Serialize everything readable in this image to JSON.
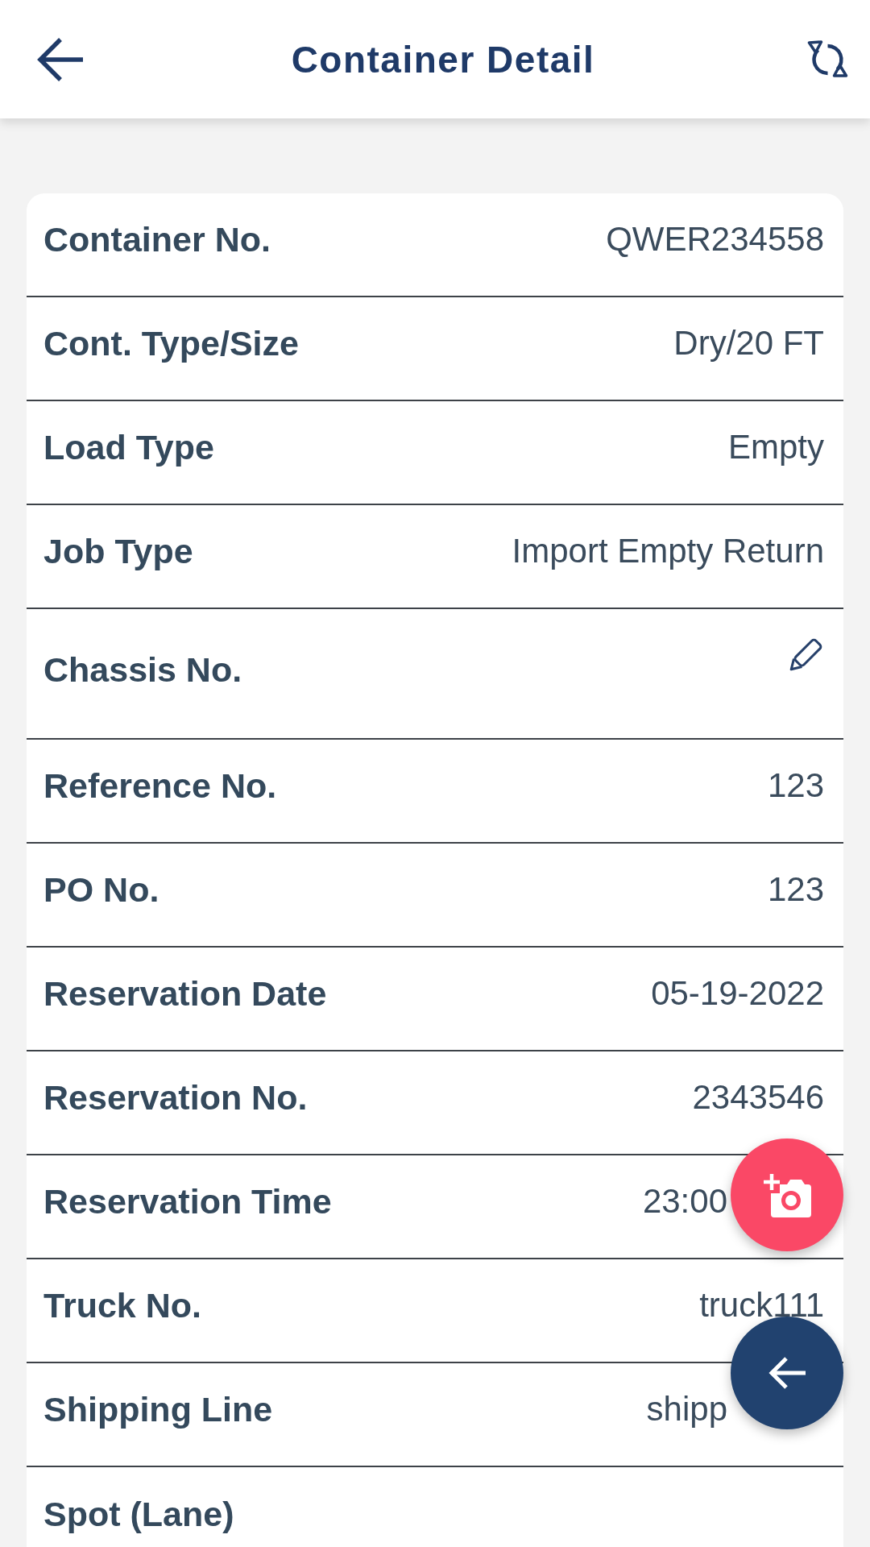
{
  "header": {
    "title": "Container Detail"
  },
  "details": [
    {
      "label": "Container No.",
      "kind": "text",
      "value": "QWER234558"
    },
    {
      "label": "Cont. Type/Size",
      "kind": "text",
      "value": "Dry/20 FT"
    },
    {
      "label": "Load Type",
      "kind": "text",
      "value": "Empty"
    },
    {
      "label": "Job Type",
      "kind": "text",
      "value": "Import Empty Return"
    },
    {
      "label": "Chassis No.",
      "kind": "edit"
    },
    {
      "label": "Reference No.",
      "kind": "text",
      "value": "123"
    },
    {
      "label": "PO No.",
      "kind": "text",
      "value": "123"
    },
    {
      "label": "Reservation Date",
      "kind": "text",
      "value": "05-19-2022"
    },
    {
      "label": "Reservation No.",
      "kind": "text",
      "value": "2343546"
    },
    {
      "label": "Reservation Time",
      "kind": "text",
      "value": "23:00",
      "partly_covered": true
    },
    {
      "label": "Truck No.",
      "kind": "text",
      "value": "truck111"
    },
    {
      "label": "Shipping Line",
      "kind": "text",
      "value": "shipp",
      "partly_covered": true
    },
    {
      "label": "Spot (Lane)",
      "kind": "text"
    }
  ]
}
